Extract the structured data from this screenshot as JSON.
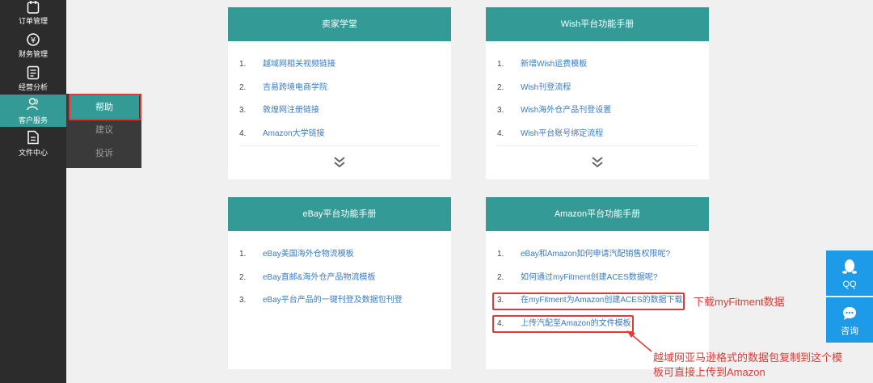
{
  "sidebar": {
    "items": [
      {
        "label": "订单管理",
        "icon": "calendar-icon"
      },
      {
        "label": "财务管理",
        "icon": "yuan-coin-icon"
      },
      {
        "label": "经营分析",
        "icon": "document-chart-icon"
      },
      {
        "label": "客户服务",
        "icon": "users-icon",
        "active": true
      },
      {
        "label": "文件中心",
        "icon": "file-icon"
      }
    ],
    "submenu": [
      {
        "label": "帮助",
        "active": true
      },
      {
        "label": "建议"
      },
      {
        "label": "投诉"
      }
    ]
  },
  "cards": {
    "seller_school": {
      "title": "卖家学堂",
      "items": [
        {
          "num": "1.",
          "text": "越域网相关视频链接"
        },
        {
          "num": "2.",
          "text": "吉易跨境电商学院"
        },
        {
          "num": "3.",
          "text": "敦煌网注册链接"
        },
        {
          "num": "4.",
          "text": "Amazon大学链接"
        }
      ]
    },
    "wish": {
      "title": "Wish平台功能手册",
      "items": [
        {
          "num": "1.",
          "text": "新增Wish运费模板"
        },
        {
          "num": "2.",
          "text": "Wish刊登流程"
        },
        {
          "num": "3.",
          "text": "Wish海外仓产品刊登设置"
        },
        {
          "num": "4.",
          "text": "Wish平台账号绑定流程"
        }
      ]
    },
    "ebay": {
      "title": "eBay平台功能手册",
      "items": [
        {
          "num": "1.",
          "text": "eBay美国海外仓物流模板"
        },
        {
          "num": "2.",
          "text": "eBay直邮&海外仓产品物流模板"
        },
        {
          "num": "3.",
          "text": "eBay平台产品的一键刊登及数据包刊登"
        }
      ]
    },
    "amazon": {
      "title": "Amazon平台功能手册",
      "items": [
        {
          "num": "1.",
          "text": "eBay和Amazon如何申请汽配销售权限呢?"
        },
        {
          "num": "2.",
          "text": "如何通过myFitment创建ACES数据呢?"
        },
        {
          "num": "3.",
          "text": "在myFitment为Amazon创建ACES的数据下载"
        },
        {
          "num": "4.",
          "text": "上传汽配至Amazon的文件模板"
        }
      ]
    }
  },
  "annotations": {
    "download_note": "下载myFitment数据",
    "upload_note_line1": "越域网亚马逊格式的数据包复制到这个模",
    "upload_note_line2": "板可直接上传到Amazon"
  },
  "float_buttons": [
    {
      "label": "QQ",
      "icon": "penguin-icon"
    },
    {
      "label": "咨询",
      "icon": "chat-bubble-icon"
    }
  ],
  "colors": {
    "accent": "#339a96",
    "sidebar": "#2c2c2c",
    "link": "#3a7bbf",
    "annotation": "#e53935",
    "float": "#1e9be8"
  }
}
